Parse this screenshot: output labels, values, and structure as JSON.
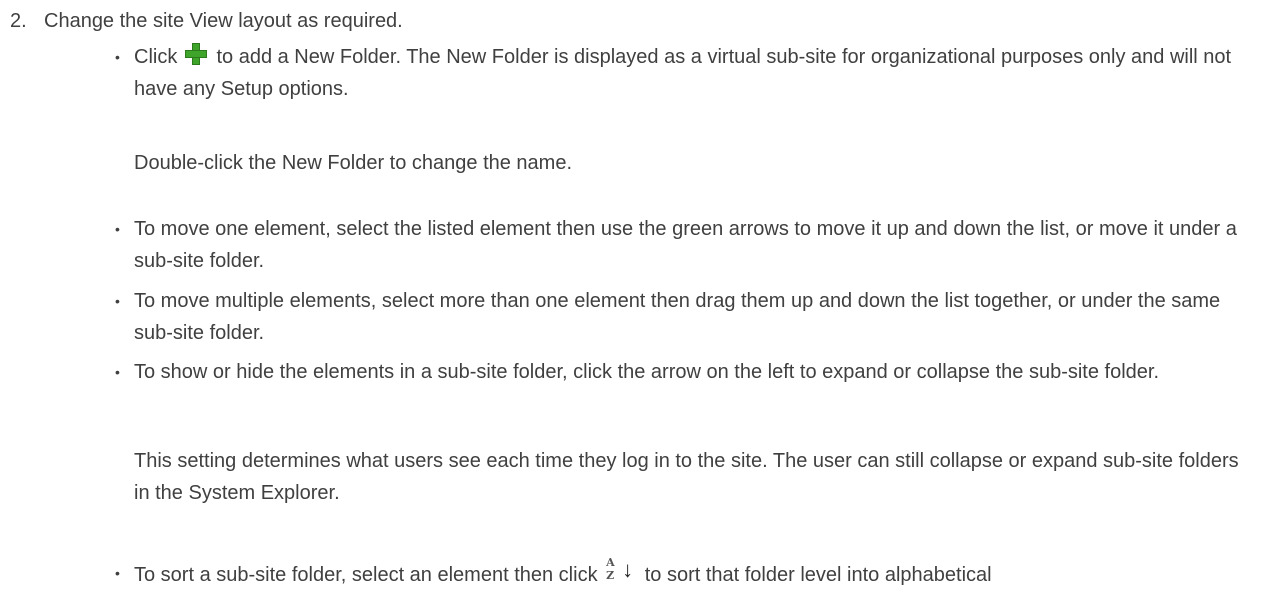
{
  "step": {
    "number": "2.",
    "heading": "Change the site View layout as required."
  },
  "bullets": [
    {
      "pre": "Click",
      "icon": "green-plus-icon",
      "post": "to add a New Folder. The New Folder is displayed as a virtual sub-site for organizational purposes only and will not have any Setup options.",
      "note": "Double-click the New Folder to change the name."
    },
    {
      "text": "To move one element, select the listed element then use the green arrows to move it up and down the list, or move it under a sub-site folder."
    },
    {
      "text": "To move multiple elements, select more than one element then drag them up and down the list together, or under the same sub-site folder."
    },
    {
      "text": "To show or hide the elements in a sub-site folder, click the arrow on the left to expand or collapse the sub-site folder.",
      "note": "This setting determines what users see each time they log in to the site. The user can still collapse or expand sub-site folders in the System Explorer."
    },
    {
      "pre": "To sort a sub-site folder, select an element then click",
      "icon": "sort-az-icon",
      "post": "to sort that folder level into alphabetical"
    }
  ],
  "colors": {
    "text": "#404040",
    "plus_icon": "#3fa52a"
  }
}
